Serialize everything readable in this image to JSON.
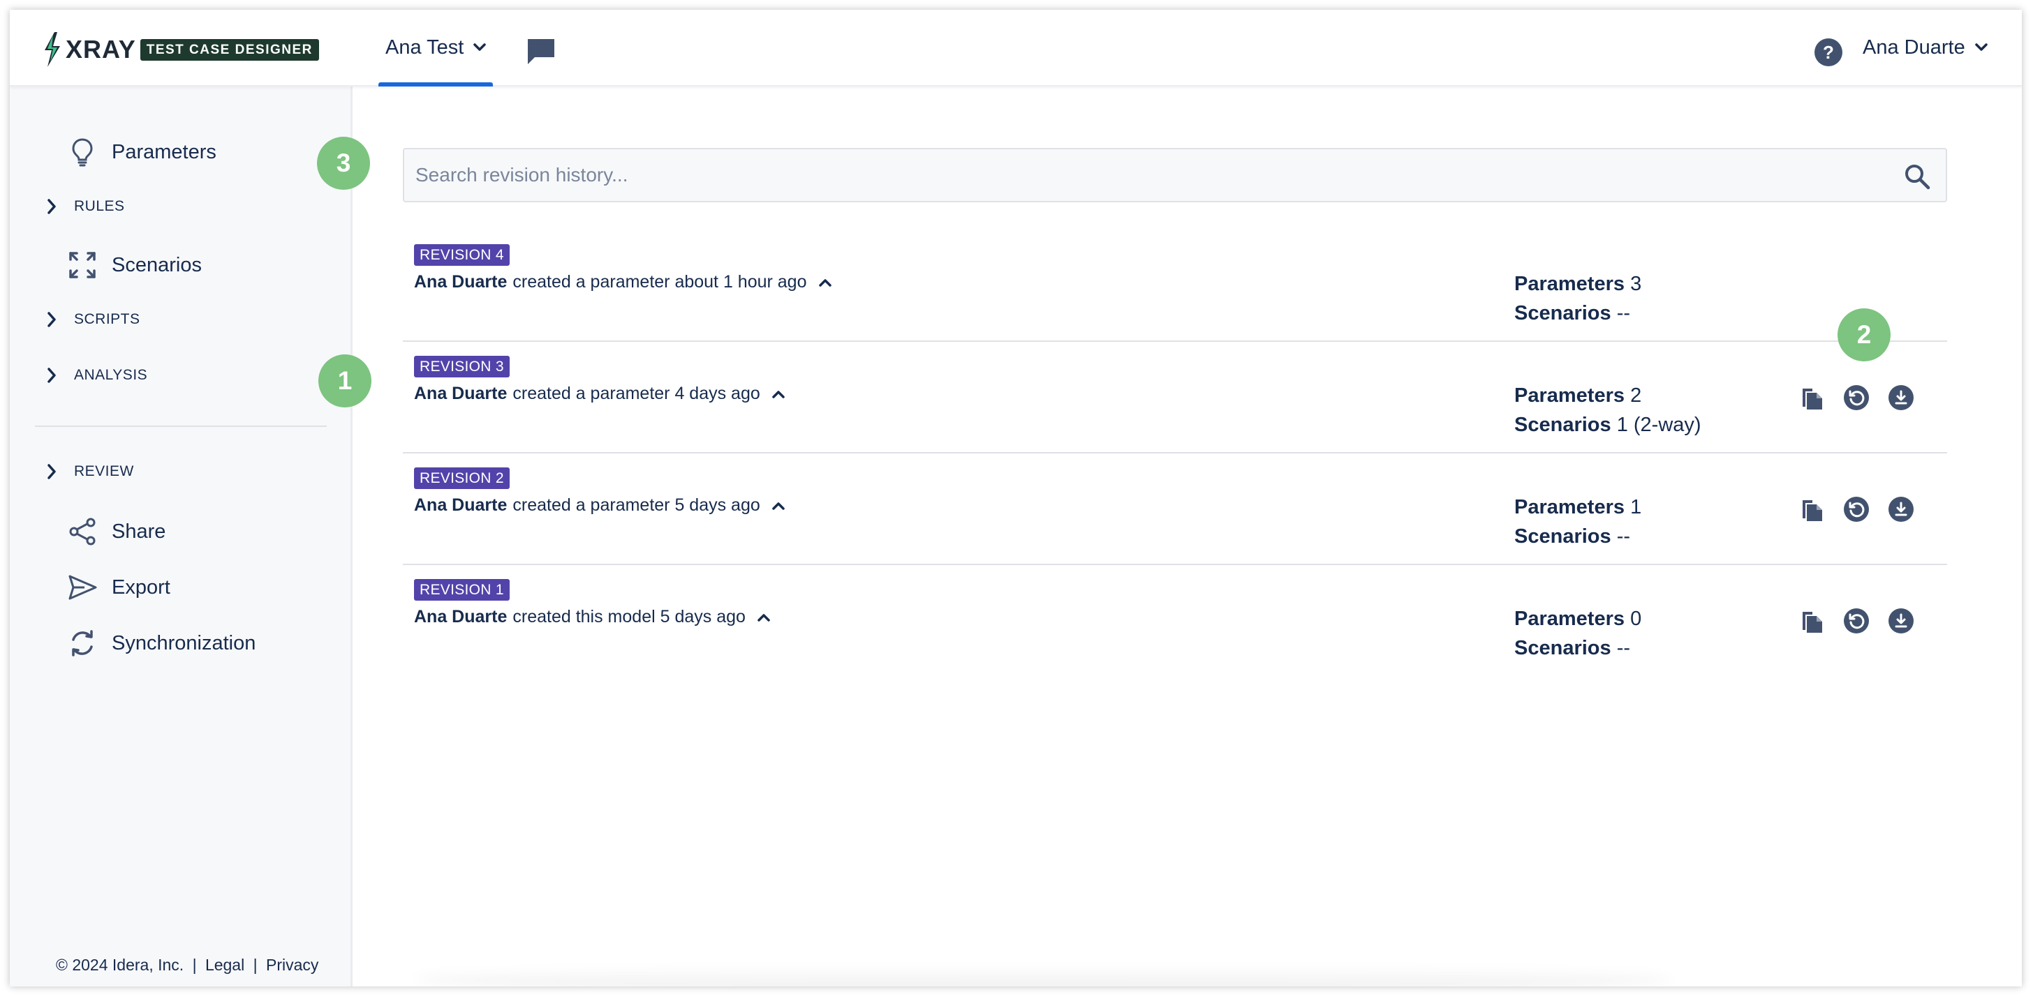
{
  "header": {
    "logo_text": "XRAY",
    "logo_badge": "TEST CASE DESIGNER",
    "project": "Ana Test",
    "user": "Ana Duarte",
    "icons": {
      "chat": "chat-icon",
      "help": "help-icon"
    }
  },
  "sidebar": {
    "parameters": "Parameters",
    "rules": "RULES",
    "scenarios": "Scenarios",
    "scripts": "SCRIPTS",
    "analysis": "ANALYSIS",
    "review": "REVIEW",
    "share": "Share",
    "export": "Export",
    "synchronization": "Synchronization"
  },
  "footer": {
    "copyright": "© 2024 Idera, Inc.",
    "legal": "Legal",
    "privacy": "Privacy",
    "separator": "|"
  },
  "search": {
    "placeholder": "Search revision history..."
  },
  "revisions": [
    {
      "badge": "REVISION 4",
      "author": "Ana Duarte",
      "action": "created a parameter about 1 hour ago",
      "parameters_label": "Parameters",
      "parameters": "3",
      "scenarios_label": "Scenarios",
      "scenarios": "--"
    },
    {
      "badge": "REVISION 3",
      "author": "Ana Duarte",
      "action": "created a parameter 4 days ago",
      "parameters_label": "Parameters",
      "parameters": "2",
      "scenarios_label": "Scenarios",
      "scenarios": "1 (2-way)"
    },
    {
      "badge": "REVISION 2",
      "author": "Ana Duarte",
      "action": "created a parameter 5 days ago",
      "parameters_label": "Parameters",
      "parameters": "1",
      "scenarios_label": "Scenarios",
      "scenarios": "--"
    },
    {
      "badge": "REVISION 1",
      "author": "Ana Duarte",
      "action": "created this model 5 days ago",
      "parameters_label": "Parameters",
      "parameters": "0",
      "scenarios_label": "Scenarios",
      "scenarios": "--"
    }
  ],
  "callouts": {
    "one": "1",
    "two": "2",
    "three": "3"
  },
  "colors": {
    "badge": "#5243aa",
    "accent": "#1868db",
    "callout": "#7cc47f",
    "icon": "#42526e"
  }
}
